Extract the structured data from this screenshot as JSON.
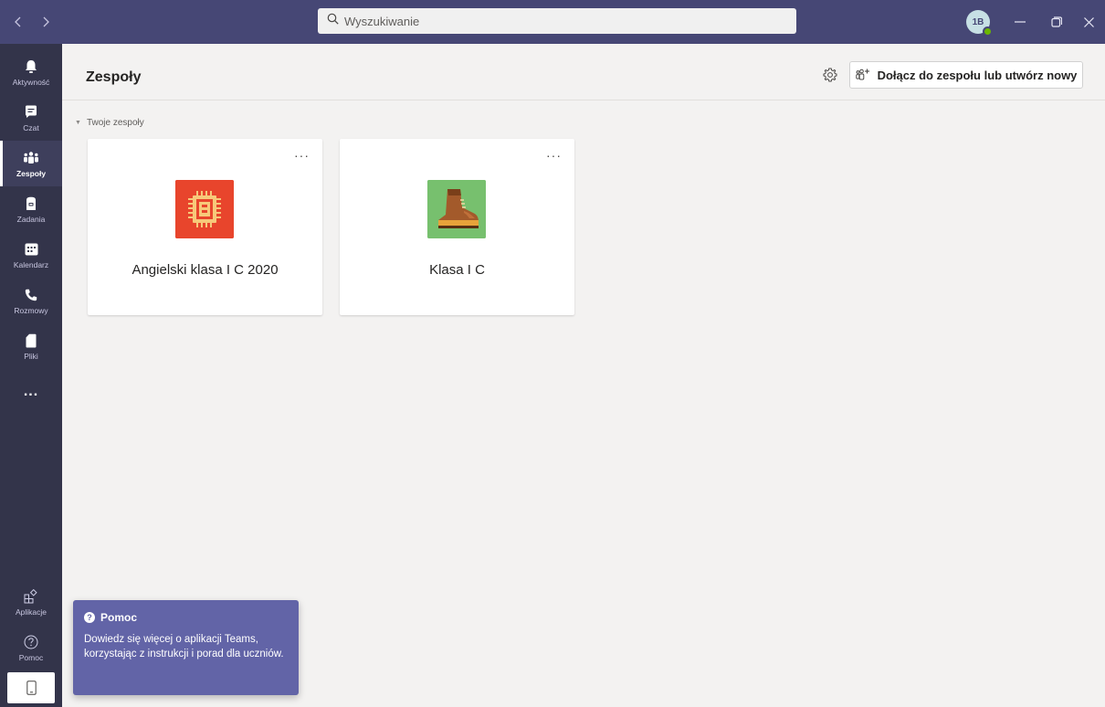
{
  "titlebar": {
    "back_icon": "chevron-left-icon",
    "forward_icon": "chevron-right-icon",
    "search_placeholder": "Wyszukiwanie",
    "avatar_initials": "1B",
    "presence_color": "#6bb700"
  },
  "rail": {
    "items": [
      {
        "label": "Aktywność",
        "icon": "bell-icon"
      },
      {
        "label": "Czat",
        "icon": "chat-icon"
      },
      {
        "label": "Zespoły",
        "icon": "teams-icon",
        "active": true
      },
      {
        "label": "Zadania",
        "icon": "assignments-icon"
      },
      {
        "label": "Kalendarz",
        "icon": "calendar-icon"
      },
      {
        "label": "Rozmowy",
        "icon": "phone-icon"
      },
      {
        "label": "Pliki",
        "icon": "file-icon"
      }
    ],
    "more_label": "...",
    "bottom": [
      {
        "label": "Aplikacje",
        "icon": "apps-icon"
      },
      {
        "label": "Pomoc",
        "icon": "help-icon"
      }
    ]
  },
  "header": {
    "title": "Zespoły",
    "join_button": "Dołącz do zespołu lub utwórz nowy"
  },
  "section": {
    "label": "Twoje zespoły"
  },
  "teams": [
    {
      "name": "Angielski klasa I C 2020",
      "logo_color": "#e8452c",
      "logo": "chip-icon"
    },
    {
      "name": "Klasa I C",
      "logo_color": "#77c06e",
      "logo": "boot-icon"
    }
  ],
  "help": {
    "title": "Pomoc",
    "body": "Dowiedz się więcej o aplikacji Teams, korzystając z instrukcji i porad dla uczniów."
  },
  "colors": {
    "titlebar": "#464775",
    "rail": "#33344a",
    "accent": "#6264a7"
  }
}
